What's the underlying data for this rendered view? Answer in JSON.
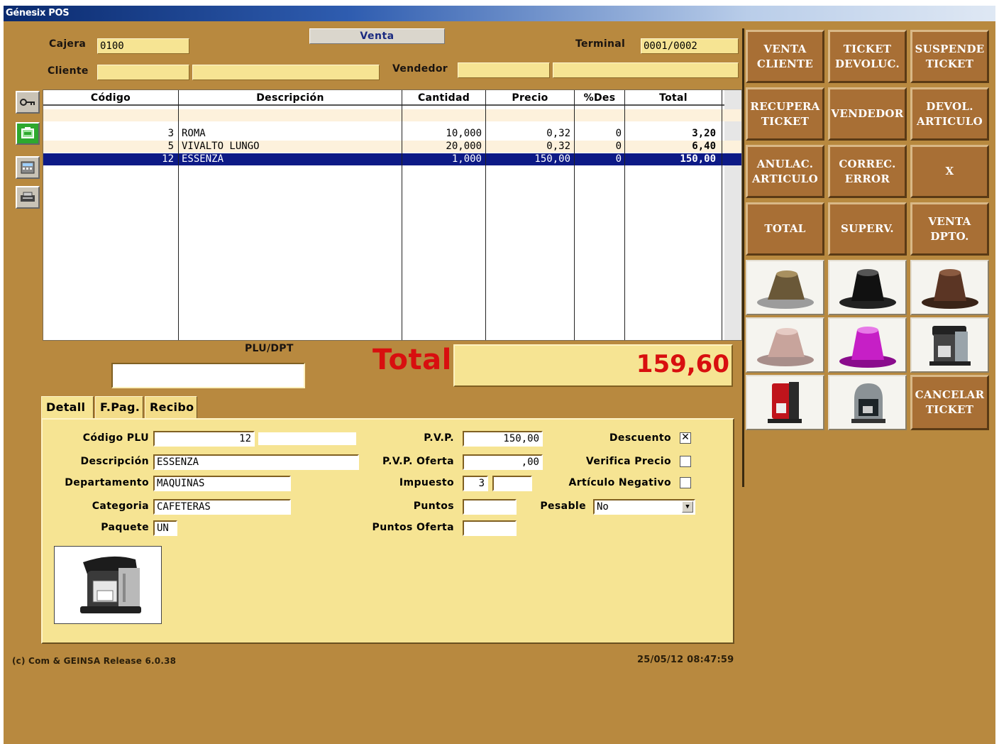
{
  "window": {
    "title": "Génesix POS"
  },
  "header": {
    "cajera_label": "Cajera",
    "cajera_value": "0100",
    "mode": "Venta",
    "terminal_label": "Terminal",
    "terminal_value": "0001/0002",
    "cliente_label": "Cliente",
    "vendedor_label": "Vendedor"
  },
  "grid": {
    "columns": [
      "Código",
      "Descripción",
      "Cantidad",
      "Precio",
      "%Des",
      "Total"
    ],
    "rows": [
      {
        "codigo": "3",
        "descripcion": "ROMA",
        "cantidad": "10,000",
        "precio": "0,32",
        "des": "0",
        "total": "3,20"
      },
      {
        "codigo": "5",
        "descripcion": "VIVALTO LUNGO",
        "cantidad": "20,000",
        "precio": "0,32",
        "des": "0",
        "total": "6,40"
      },
      {
        "codigo": "12",
        "descripcion": "ESSENZA",
        "cantidad": "1,000",
        "precio": "150,00",
        "des": "0",
        "total": "150,00"
      }
    ]
  },
  "plu": {
    "label": "PLU/DPT"
  },
  "total": {
    "label": "Total",
    "value": "159,60"
  },
  "tabs": [
    "Detall",
    "F.Pag.",
    "Recibo"
  ],
  "detail": {
    "codigo_plu_label": "Código PLU",
    "codigo_plu": "12",
    "descripcion_label": "Descripción",
    "descripcion": "ESSENZA",
    "departamento_label": "Departamento",
    "departamento": "MAQUINAS",
    "categoria_label": "Categoria",
    "categoria": "CAFETERAS",
    "paquete_label": "Paquete",
    "paquete": "UN",
    "pvp_label": "P.V.P.",
    "pvp": "150,00",
    "pvp_oferta_label": "P.V.P. Oferta",
    "pvp_oferta": ",00",
    "impuesto_label": "Impuesto",
    "impuesto": "3",
    "puntos_label": "Puntos",
    "puntos_oferta_label": "Puntos Oferta",
    "descuento_label": "Descuento",
    "descuento_checked": true,
    "verifica_label": "Verifica Precio",
    "verifica_checked": false,
    "negativo_label": "Artículo Negativo",
    "negativo_checked": false,
    "pesable_label": "Pesable",
    "pesable_value": "No"
  },
  "footer": {
    "copyright": "(c) Com & GEINSA Release 6.0.38",
    "datetime": "25/05/12 08:47:59"
  },
  "buttons": [
    "VENTA\nCLIENTE",
    "TICKET\nDEVOLUC.",
    "SUSPENDE\nTICKET",
    "RECUPERA\nTICKET",
    "VENDEDOR",
    "DEVOL.\nARTICULO",
    "ANULAC.\nARTICULO",
    "CORREC.\nERROR",
    "X",
    "TOTAL",
    "SUPERV.",
    "VENTA\nDPTO."
  ],
  "cancel_button": "CANCELAR\nTICKET",
  "colors": {
    "accent_red": "#d80f0f",
    "selected_row": "#0d1a86",
    "button_brown": "#a86f35",
    "panel_yellow": "#f6e493"
  }
}
